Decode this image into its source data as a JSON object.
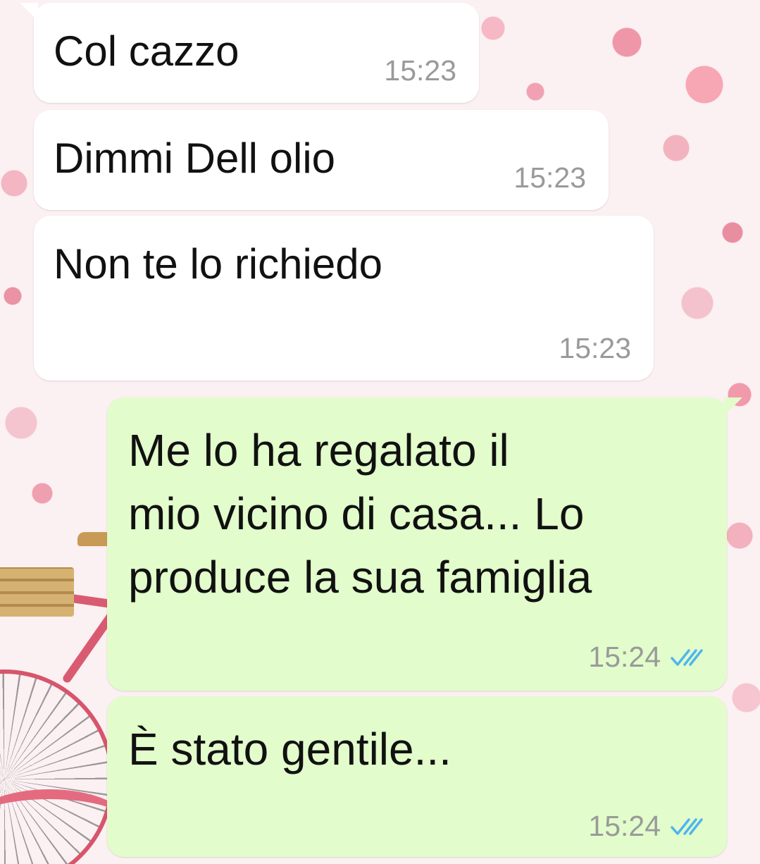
{
  "colors": {
    "incoming_bubble": "#ffffff",
    "outgoing_bubble": "#e2fccb",
    "text": "#111111",
    "timestamp": "#9a9a9a",
    "read_ticks": "#4fb6ec"
  },
  "messages": [
    {
      "direction": "incoming",
      "text": "Col cazzo",
      "time": "15:23"
    },
    {
      "direction": "incoming",
      "text": "Dimmi Dell olio",
      "time": "15:23"
    },
    {
      "direction": "incoming",
      "text": "Non te lo richiedo",
      "time": "15:23"
    },
    {
      "direction": "outgoing",
      "text": "Me lo ha regalato il\nmio vicino di casa... Lo\nproduce la sua famiglia",
      "time": "15:24",
      "status_icon": "double-check-read-icon"
    },
    {
      "direction": "outgoing",
      "text": "È stato gentile...",
      "time": "15:24",
      "status_icon": "double-check-read-icon"
    }
  ]
}
